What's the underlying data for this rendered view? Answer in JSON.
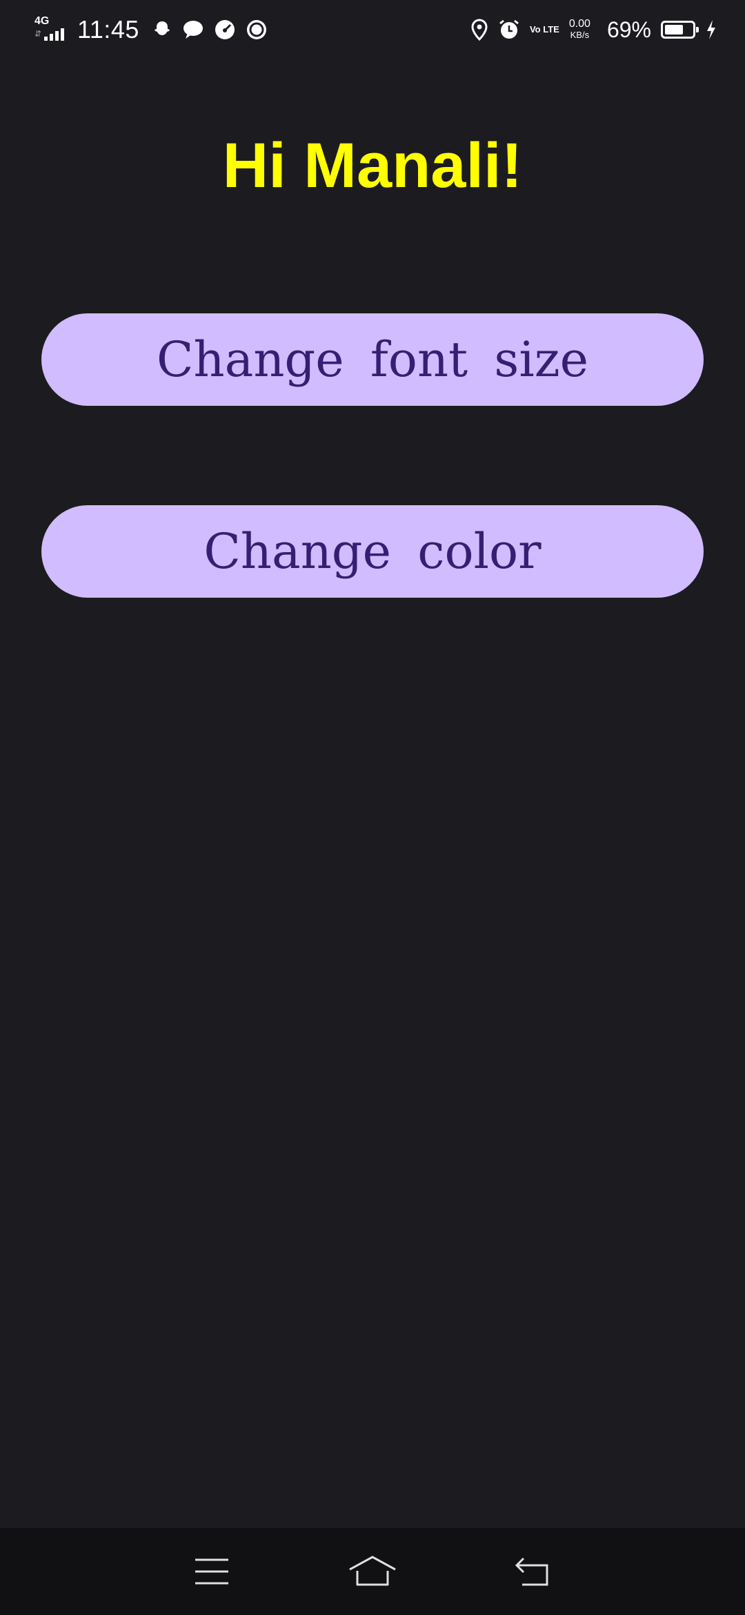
{
  "status_bar": {
    "network_type": "4G",
    "time": "11:45",
    "notification_icons": [
      "snapchat-icon",
      "message-icon",
      "speedometer-icon",
      "sync-icon"
    ],
    "volte": "Vo LTE",
    "speed_value": "0.00",
    "speed_unit": "KB/s",
    "battery_percent": "69%",
    "battery_level": 0.69
  },
  "main": {
    "greeting": "Hi Manali!",
    "buttons": {
      "font_size": "Change font size",
      "color": "Change color"
    }
  },
  "nav_bar": {
    "icons": [
      "menu-icon",
      "home-icon",
      "back-icon"
    ]
  },
  "colors": {
    "background": "#1c1b1f",
    "greeting": "#ffff00",
    "button_bg": "#d0bcff",
    "button_text": "#381e72"
  }
}
